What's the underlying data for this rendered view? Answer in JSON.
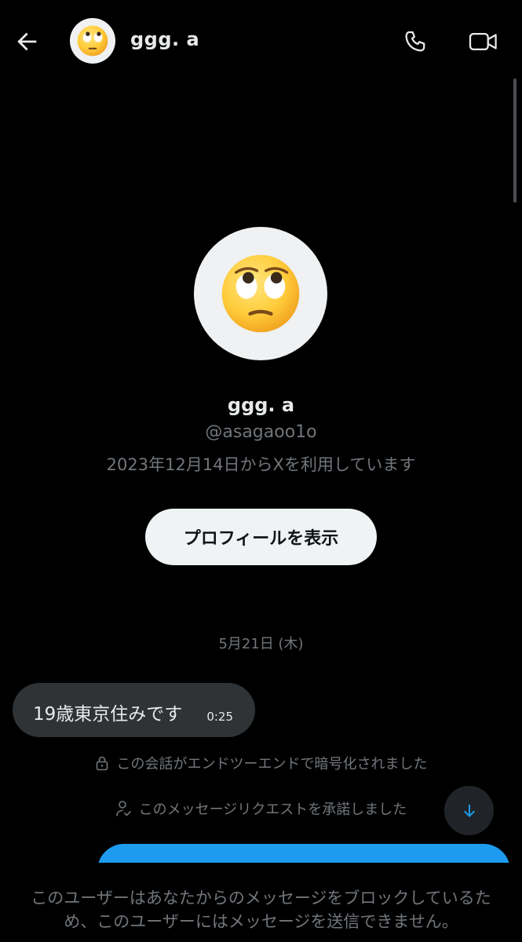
{
  "header": {
    "name": "ggg. a",
    "back_icon": "arrow-left-icon",
    "call_icon": "phone-icon",
    "video_icon": "video-camera-icon",
    "avatar_emoji": "🙄"
  },
  "profile": {
    "avatar_emoji": "🙄",
    "name": "ggg. a",
    "handle": "@asagaoo1o",
    "joined": "2023年12月14日からXを利用しています",
    "view_profile_label": "プロフィールを表示"
  },
  "conversation": {
    "date_separator": "5月21日 (木)",
    "messages": [
      {
        "text": "19歳東京住みです",
        "time": "0:25"
      }
    ],
    "system_encrypted": "この会話がエンドツーエンドで暗号化されました",
    "system_accepted": "このメッセージリクエストを承諾しました"
  },
  "footer": {
    "blocked_notice": "このユーザーはあなたからのメッセージをブロックしているため、このユーザーにはメッセージを送信できません。"
  },
  "colors": {
    "background": "#000000",
    "text_primary": "#e7e9ea",
    "text_secondary": "#71767b",
    "bubble_received": "#2f3336",
    "bubble_sent": "#1d9bf0",
    "accent": "#1d9bf0"
  }
}
